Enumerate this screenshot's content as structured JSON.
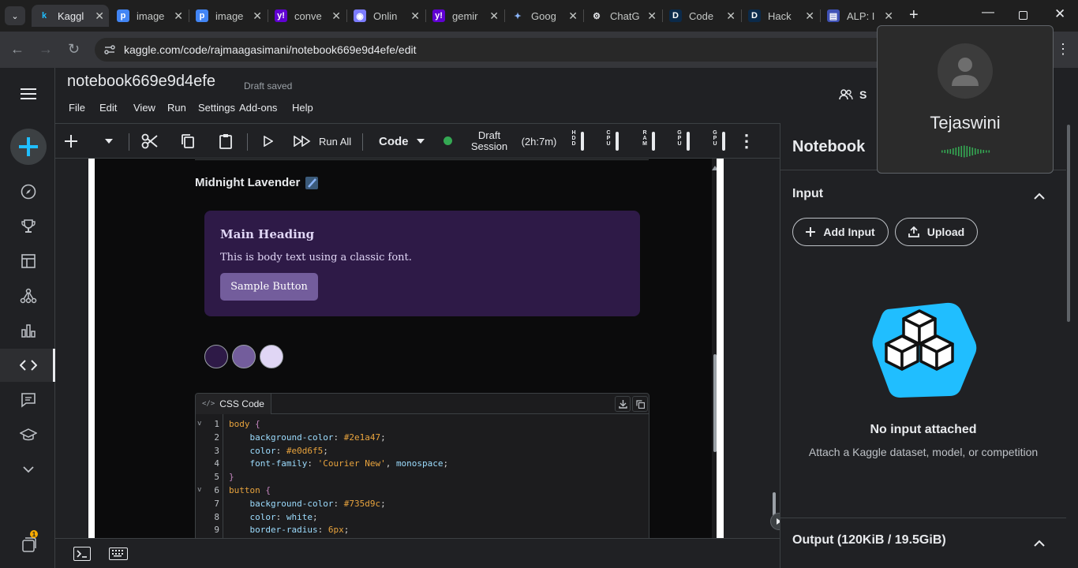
{
  "browser": {
    "tabs": [
      {
        "label": "Kaggl",
        "active": true,
        "icon": "kaggle-k-icon"
      },
      {
        "label": "image",
        "icon": "p-icon"
      },
      {
        "label": "image",
        "icon": "p-icon"
      },
      {
        "label": "conve",
        "icon": "yahoo-icon"
      },
      {
        "label": "Onlin",
        "icon": "circle-icon"
      },
      {
        "label": "gemir",
        "icon": "yahoo-icon"
      },
      {
        "label": "Goog",
        "icon": "gemini-icon"
      },
      {
        "label": "ChatG",
        "icon": "chatgpt-icon"
      },
      {
        "label": "Code",
        "icon": "d-icon"
      },
      {
        "label": "Hack",
        "icon": "d-icon"
      },
      {
        "label": "ALP: I",
        "icon": "alp-icon"
      }
    ],
    "url": "kaggle.com/code/rajmaagasimani/notebook669e9d4efe/edit"
  },
  "header": {
    "title": "notebook669e9d4efe",
    "status": "Draft saved",
    "menu": [
      "File",
      "Edit",
      "View",
      "Run",
      "Settings",
      "Add-ons",
      "Help"
    ],
    "share_label": "S"
  },
  "toolbar": {
    "run_all": "Run All",
    "cell_type": "Code",
    "session_line1": "Draft",
    "session_line2": "Session",
    "session_time": "(2h:7m)",
    "meters": [
      {
        "label": "HDD"
      },
      {
        "label": "CPU"
      },
      {
        "label": "RAM"
      },
      {
        "label": "GPU"
      },
      {
        "label": "GPU"
      }
    ]
  },
  "output": {
    "theme_title": "Midnight Lavender",
    "card": {
      "heading": "Main Heading",
      "body": "This is body text using a classic font.",
      "button": "Sample Button"
    },
    "swatches": [
      "#2e1a47",
      "#735d9c",
      "#e0d6f5"
    ],
    "code_block": {
      "title": "CSS Code",
      "lines": [
        {
          "n": "1",
          "fold": "v",
          "parts": [
            {
              "t": "body",
              "c": "#e8a33d"
            },
            {
              "t": " {",
              "c": "#c586c0"
            }
          ]
        },
        {
          "n": "2",
          "fold": "",
          "parts": [
            {
              "t": "    background-color",
              "c": "#9cdcfe"
            },
            {
              "t": ": ",
              "c": "#d4d4d4"
            },
            {
              "t": "#2e1a47",
              "c": "#e8a33d"
            },
            {
              "t": ";",
              "c": "#d4d4d4"
            }
          ]
        },
        {
          "n": "3",
          "fold": "",
          "parts": [
            {
              "t": "    color",
              "c": "#9cdcfe"
            },
            {
              "t": ": ",
              "c": "#d4d4d4"
            },
            {
              "t": "#e0d6f5",
              "c": "#e8a33d"
            },
            {
              "t": ";",
              "c": "#d4d4d4"
            }
          ]
        },
        {
          "n": "4",
          "fold": "",
          "parts": [
            {
              "t": "    font-family",
              "c": "#9cdcfe"
            },
            {
              "t": ": ",
              "c": "#d4d4d4"
            },
            {
              "t": "'Courier New'",
              "c": "#e8a33d"
            },
            {
              "t": ", ",
              "c": "#d4d4d4"
            },
            {
              "t": "monospace",
              "c": "#9cdcfe"
            },
            {
              "t": ";",
              "c": "#d4d4d4"
            }
          ]
        },
        {
          "n": "5",
          "fold": "",
          "parts": [
            {
              "t": "}",
              "c": "#c586c0"
            }
          ]
        },
        {
          "n": "6",
          "fold": "v",
          "parts": [
            {
              "t": "button",
              "c": "#e8a33d"
            },
            {
              "t": " {",
              "c": "#c586c0"
            }
          ]
        },
        {
          "n": "7",
          "fold": "",
          "parts": [
            {
              "t": "    background-color",
              "c": "#9cdcfe"
            },
            {
              "t": ": ",
              "c": "#d4d4d4"
            },
            {
              "t": "#735d9c",
              "c": "#e8a33d"
            },
            {
              "t": ";",
              "c": "#d4d4d4"
            }
          ]
        },
        {
          "n": "8",
          "fold": "",
          "parts": [
            {
              "t": "    color",
              "c": "#9cdcfe"
            },
            {
              "t": ": ",
              "c": "#d4d4d4"
            },
            {
              "t": "white",
              "c": "#9cdcfe"
            },
            {
              "t": ";",
              "c": "#d4d4d4"
            }
          ]
        },
        {
          "n": "9",
          "fold": "",
          "parts": [
            {
              "t": "    border-radius",
              "c": "#9cdcfe"
            },
            {
              "t": ": ",
              "c": "#d4d4d4"
            },
            {
              "t": "6px",
              "c": "#e8a33d"
            },
            {
              "t": ";",
              "c": "#d4d4d4"
            }
          ]
        }
      ]
    }
  },
  "sidepanel": {
    "title": "Notebook",
    "input_section": "Input",
    "add_input": "Add Input",
    "upload": "Upload",
    "empty_title": "No input attached",
    "empty_desc": "Attach a Kaggle dataset, model, or competition",
    "output_section": "Output (120KiB / 19.5GiB)"
  },
  "popup": {
    "name": "Tejaswini"
  },
  "notifications": {
    "badge": "1"
  },
  "colors": {
    "accent": "#20beff",
    "card_bg": "#2e1a47",
    "button_bg": "#735d9c",
    "status_green": "#34a853"
  }
}
